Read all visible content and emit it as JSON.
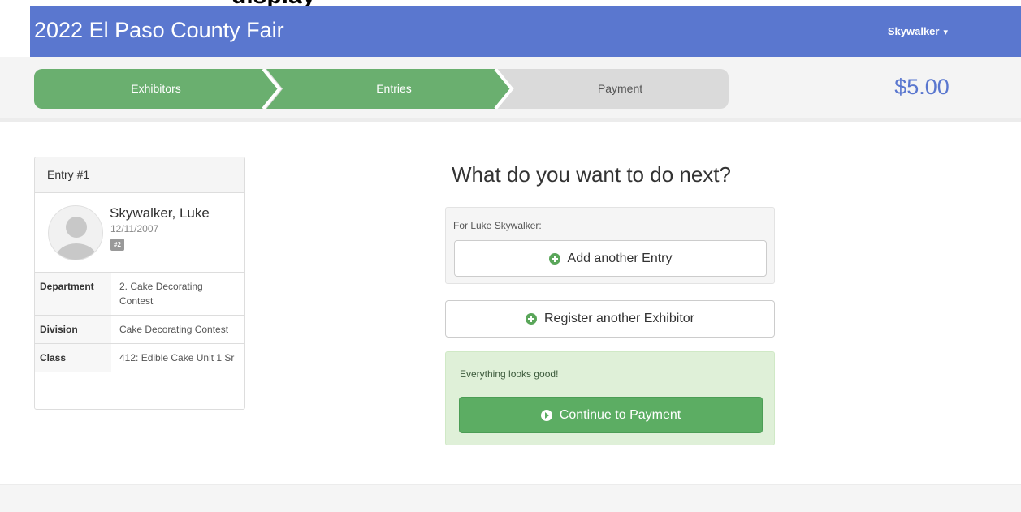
{
  "navbar": {
    "brand": "2022 El Paso County Fair",
    "user_menu": "Skywalker",
    "caret": "▾"
  },
  "steps": [
    {
      "label": "Exhibitors",
      "state": "complete"
    },
    {
      "label": "Entries",
      "state": "active"
    },
    {
      "label": "Payment",
      "state": "pending"
    }
  ],
  "total": "$5.00",
  "colors": {
    "brand_blue": "#5a77cf",
    "step_green": "#6aaf6f",
    "step_gray": "#dadada",
    "success_bg": "#dff0d8",
    "success_button": "#5cad63"
  },
  "entry": {
    "heading": "Entry #1",
    "exhibitor_name": "Skywalker, Luke",
    "exhibitor_dob": "12/11/2007",
    "exhibitor_badge": "#2",
    "details": [
      {
        "label": "Department",
        "value": "2. Cake Decorating Contest"
      },
      {
        "label": "Division",
        "value": "Cake Decorating Contest"
      },
      {
        "label": "Class",
        "value": "412: Edible Cake Unit 1 Sr"
      }
    ]
  },
  "next": {
    "title": "What do you want to do next?",
    "for_label": "For Luke Skywalker:",
    "add_entry_label": "Add another Entry",
    "register_label": "Register another Exhibitor",
    "status_text": "Everything looks good!",
    "continue_label": "Continue to Payment"
  }
}
